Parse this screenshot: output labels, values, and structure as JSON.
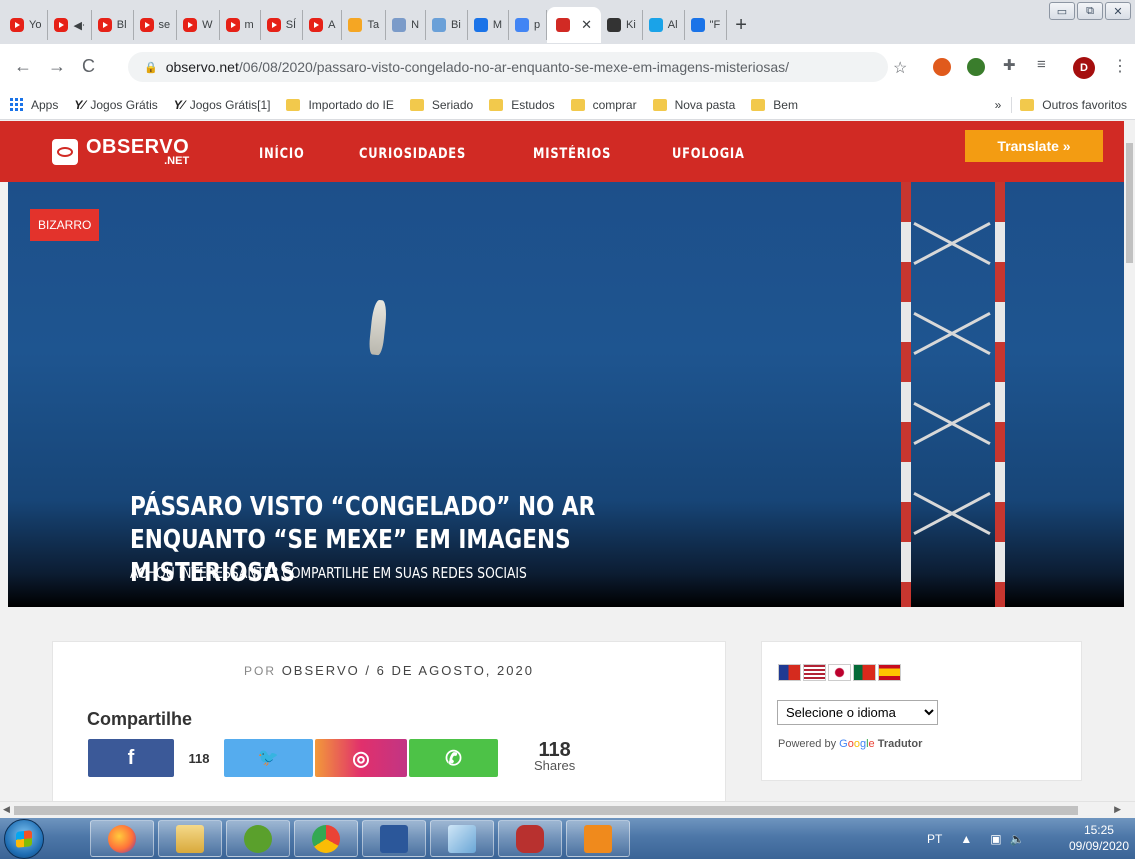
{
  "browser": {
    "tabs": [
      {
        "label": "Yo",
        "favicon": "youtube-icon",
        "color": "#e62117"
      },
      {
        "label": "◀ᐧ",
        "favicon": "youtube-icon",
        "color": "#e62117"
      },
      {
        "label": "Bl",
        "favicon": "youtube-icon",
        "color": "#e62117"
      },
      {
        "label": "se",
        "favicon": "youtube-icon",
        "color": "#e62117"
      },
      {
        "label": "W",
        "favicon": "youtube-icon",
        "color": "#e62117"
      },
      {
        "label": "m",
        "favicon": "youtube-icon",
        "color": "#e62117"
      },
      {
        "label": "SÍ",
        "favicon": "youtube-icon",
        "color": "#e62117"
      },
      {
        "label": "A",
        "favicon": "youtube-icon",
        "color": "#e62117"
      },
      {
        "label": "Ta",
        "favicon": "sun-icon",
        "color": "#f5a623"
      },
      {
        "label": "N",
        "favicon": "star-icon",
        "color": "#7b9bc9"
      },
      {
        "label": "Bi",
        "favicon": "gallery-icon",
        "color": "#6aa0d8"
      },
      {
        "label": "M",
        "favicon": "opera-icon",
        "color": "#1a73e8"
      },
      {
        "label": "p",
        "favicon": "google-icon",
        "color": "#4285f4"
      },
      {
        "label": "",
        "favicon": "observo-icon",
        "color": "#d12a24",
        "active": true
      },
      {
        "label": "Ki",
        "favicon": "wikipedia-icon",
        "color": "#333333"
      },
      {
        "label": "Al",
        "favicon": "q-icon",
        "color": "#1aa3e8"
      },
      {
        "label": "\"F",
        "favicon": "plus-circle-icon",
        "color": "#1a73e8"
      }
    ],
    "new_tab": "+",
    "url_host": "observo.net",
    "url_path": "/06/08/2020/passaro-visto-congelado-no-ar-enquanto-se-mexe-em-imagens-misteriosas/",
    "profile_initial": "D",
    "bookmarks": [
      {
        "label": "Apps",
        "icon": "apps-grid-icon"
      },
      {
        "label": "Jogos Grátis",
        "icon": "y8-icon"
      },
      {
        "label": "Jogos Grátis[1]",
        "icon": "y8-icon"
      },
      {
        "label": "Importado do IE",
        "icon": "folder-icon"
      },
      {
        "label": "Seriado",
        "icon": "folder-icon"
      },
      {
        "label": "Estudos",
        "icon": "folder-icon"
      },
      {
        "label": "comprar",
        "icon": "folder-icon"
      },
      {
        "label": "Nova pasta",
        "icon": "folder-icon"
      },
      {
        "label": "Bem",
        "icon": "folder-icon"
      }
    ],
    "bookmarks_overflow": "»",
    "other_bookmarks": "Outros favoritos"
  },
  "site": {
    "logo_name": "OBSERVO",
    "logo_tld": ".NET",
    "nav": [
      "INÍCIO",
      "CURIOSIDADES",
      "MISTÉRIOS",
      "UFOLOGIA"
    ],
    "translate_button": "Translate »",
    "brand_color": "#d12a24",
    "translate_color": "#f39c12"
  },
  "article": {
    "category": "BIZARRO",
    "title": "PÁSSARO VISTO “CONGELADO” NO AR ENQUANTO “SE MEXE” EM IMAGENS MISTERIOSAS",
    "subtitle": "ACHOU INTERESSANTE? COMPARTILHE EM SUAS REDES SOCIAIS",
    "byline_prefix": "POR",
    "author": "OBSERVO",
    "separator": "/",
    "date": "6 DE AGOSTO, 2020"
  },
  "share": {
    "heading": "Compartilhe",
    "facebook_count": "118",
    "total_count": "118",
    "total_label": "Shares",
    "buttons": [
      {
        "network": "facebook",
        "glyph": "f"
      },
      {
        "network": "twitter",
        "glyph": "🐦"
      },
      {
        "network": "instagram",
        "glyph": "◎"
      },
      {
        "network": "whatsapp",
        "glyph": "✆"
      }
    ]
  },
  "translator": {
    "select_label": "Selecione o idioma",
    "powered_by": "Powered by",
    "google": "Google",
    "tradutor": "Tradutor",
    "flags": [
      "taiwan-flag-icon",
      "usa-flag-icon",
      "japan-flag-icon",
      "portugal-flag-icon",
      "spain-flag-icon"
    ]
  },
  "taskbar": {
    "apps": [
      "firefox-icon",
      "file-explorer-icon",
      "utorrent-icon",
      "chrome-icon",
      "word-icon",
      "documents-icon",
      "game-icon",
      "pdf-icon"
    ],
    "language": "PT",
    "time": "15:25",
    "date": "09/09/2020"
  }
}
